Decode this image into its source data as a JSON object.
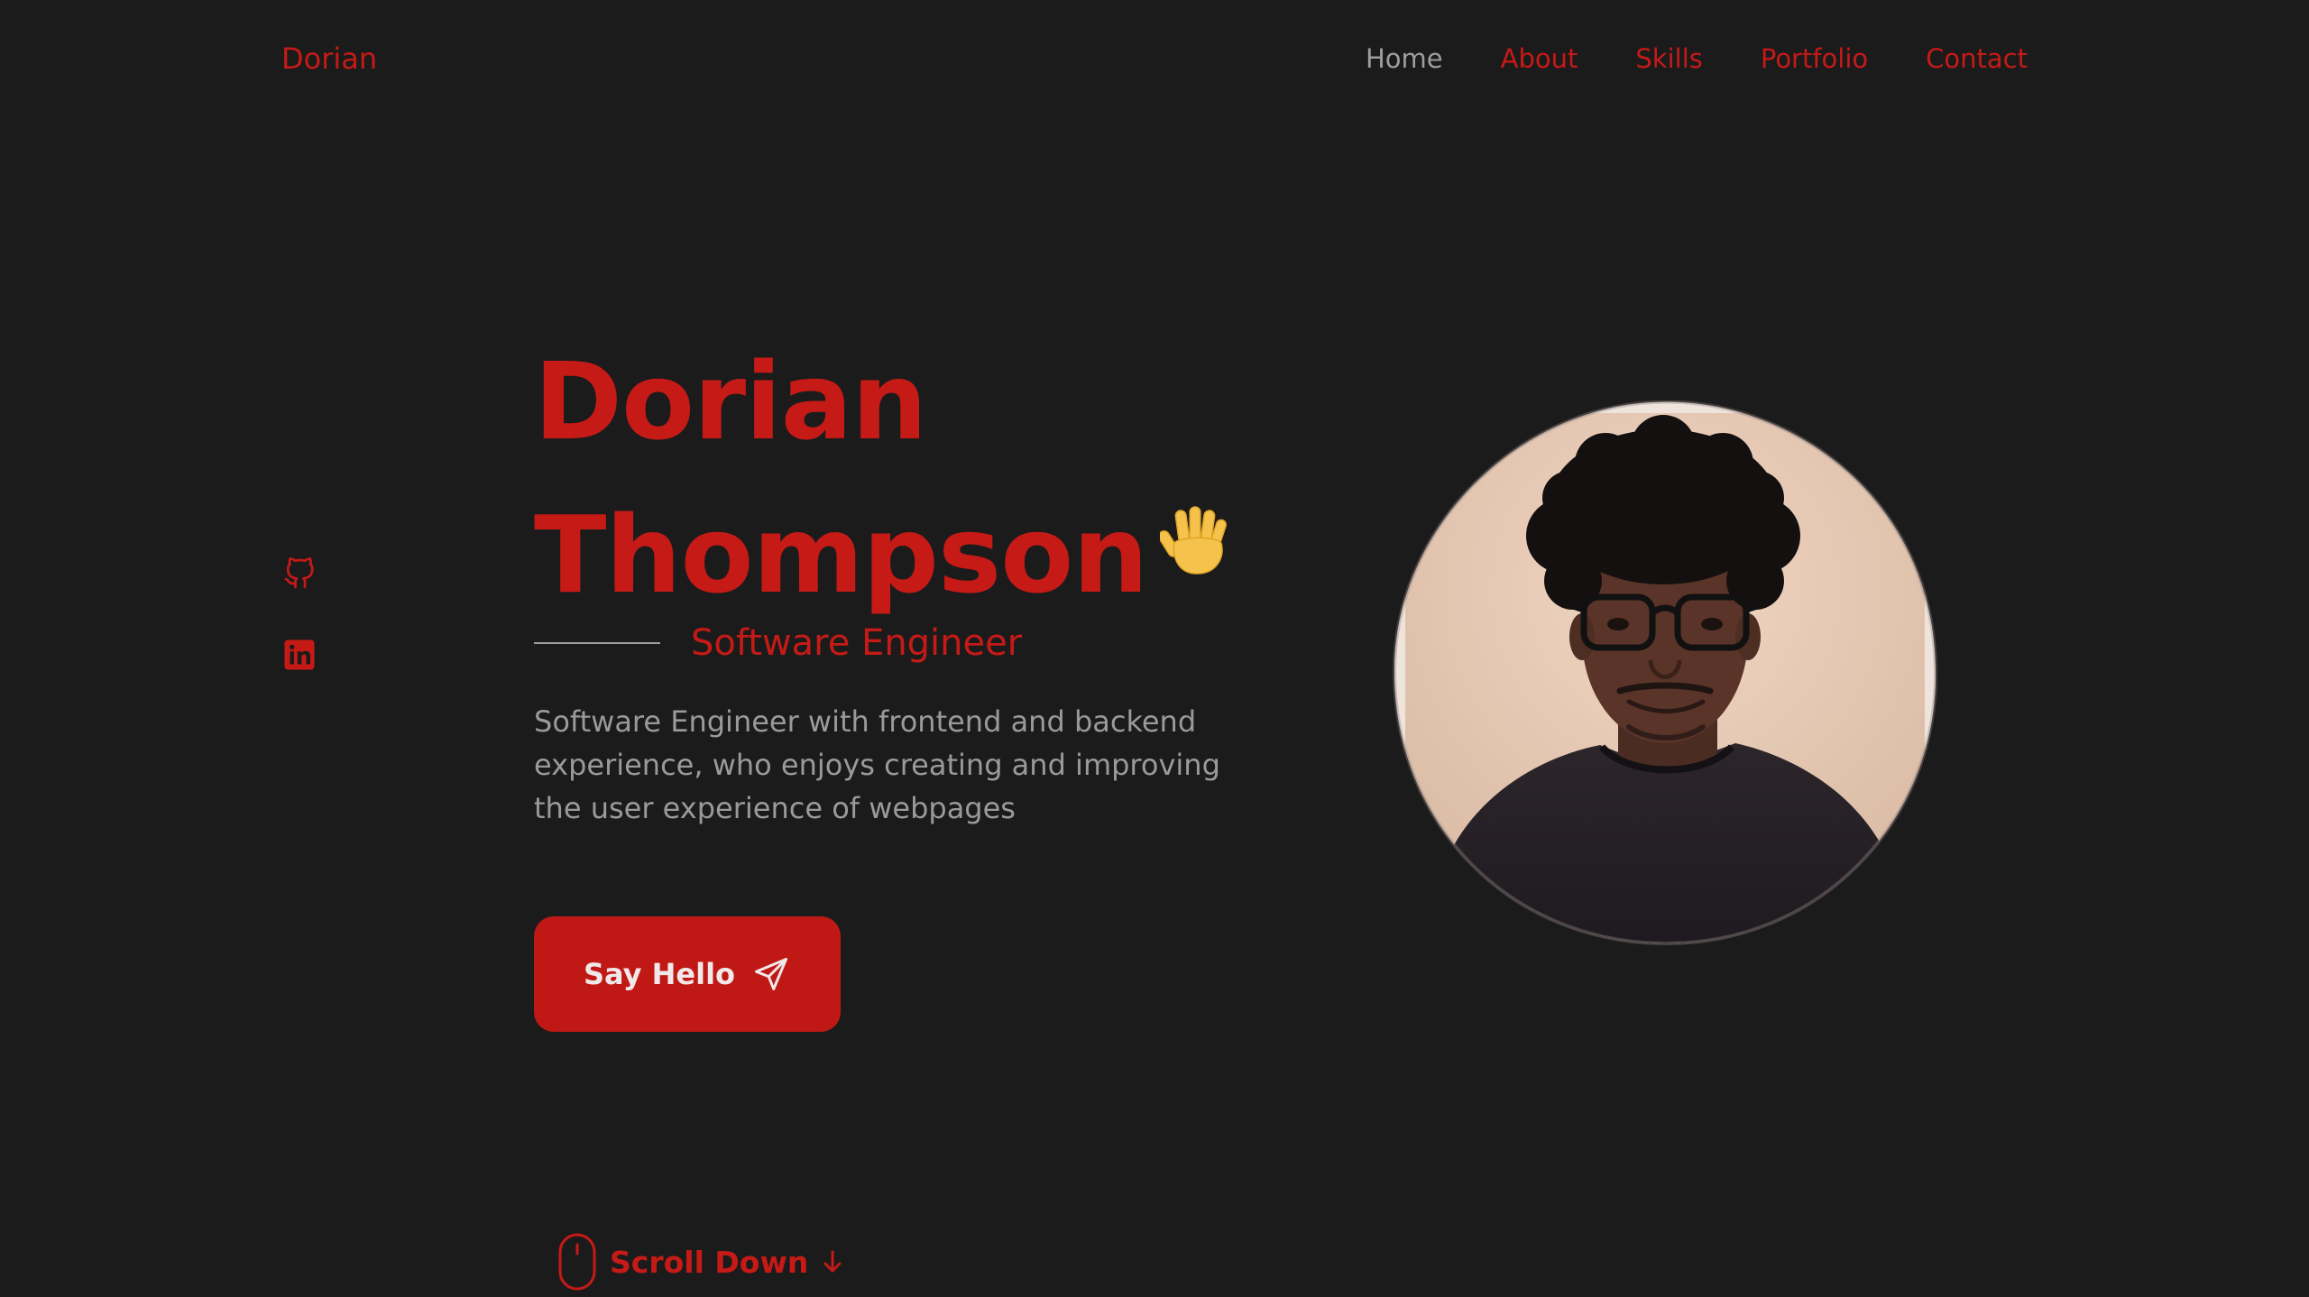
{
  "header": {
    "logo": "Dorian",
    "nav": [
      {
        "label": "Home",
        "active": true
      },
      {
        "label": "About",
        "active": false
      },
      {
        "label": "Skills",
        "active": false
      },
      {
        "label": "Portfolio",
        "active": false
      },
      {
        "label": "Contact",
        "active": false
      }
    ]
  },
  "social": [
    {
      "icon": "github-icon"
    },
    {
      "icon": "linkedin-icon"
    }
  ],
  "hero": {
    "first_name": "Dorian",
    "last_name": "Thompson",
    "wave_icon": "waving-hand-icon",
    "subtitle": "Software Engineer",
    "description": "Software Engineer with frontend and backend experience, who enjoys creating and improving the user experience of webpages",
    "button_label": "Say Hello",
    "button_icon": "send-icon",
    "scroll_label": "Scroll Down"
  },
  "profile_image": {
    "subject": "portrait-photo"
  },
  "colors": {
    "background": "#1b1b1b",
    "accent": "#c61a17",
    "muted_text": "#9a9a9a",
    "button_text": "#f1e9e9"
  }
}
